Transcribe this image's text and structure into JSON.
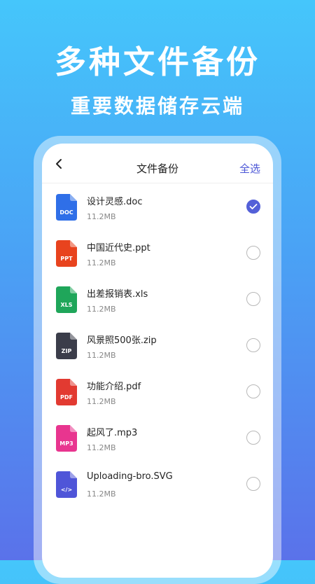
{
  "headline": "多种文件备份",
  "subline": "重要数据储存云端",
  "navbar": {
    "title": "文件备份",
    "select_all": "全选",
    "back_icon": "chevron-left-icon"
  },
  "files": [
    {
      "name": "设计灵感.doc",
      "size": "11.2MB",
      "type": "DOC",
      "color": "#2f6fe8",
      "checked": true
    },
    {
      "name": "中国近代史.ppt",
      "size": "11.2MB",
      "type": "PPT",
      "color": "#e8431e",
      "checked": false
    },
    {
      "name": "出差报销表.xls",
      "size": "11.2MB",
      "type": "XLS",
      "color": "#1fa65a",
      "checked": false
    },
    {
      "name": "风景照500张.zip",
      "size": "11.2MB",
      "type": "ZIP",
      "color": "#3b3d4a",
      "checked": false
    },
    {
      "name": "功能介绍.pdf",
      "size": "11.2MB",
      "type": "PDF",
      "color": "#e23a31",
      "checked": false
    },
    {
      "name": "起风了.mp3",
      "size": "11.2MB",
      "type": "MP3",
      "color": "#e8358f",
      "checked": false
    },
    {
      "name": "Uploading-bro.SVG",
      "size": "11.2MB",
      "type": "</>",
      "color": "#4f55d8",
      "checked": false
    }
  ],
  "colors": {
    "accent": "#5360d8",
    "select_all": "#4a55d6"
  }
}
